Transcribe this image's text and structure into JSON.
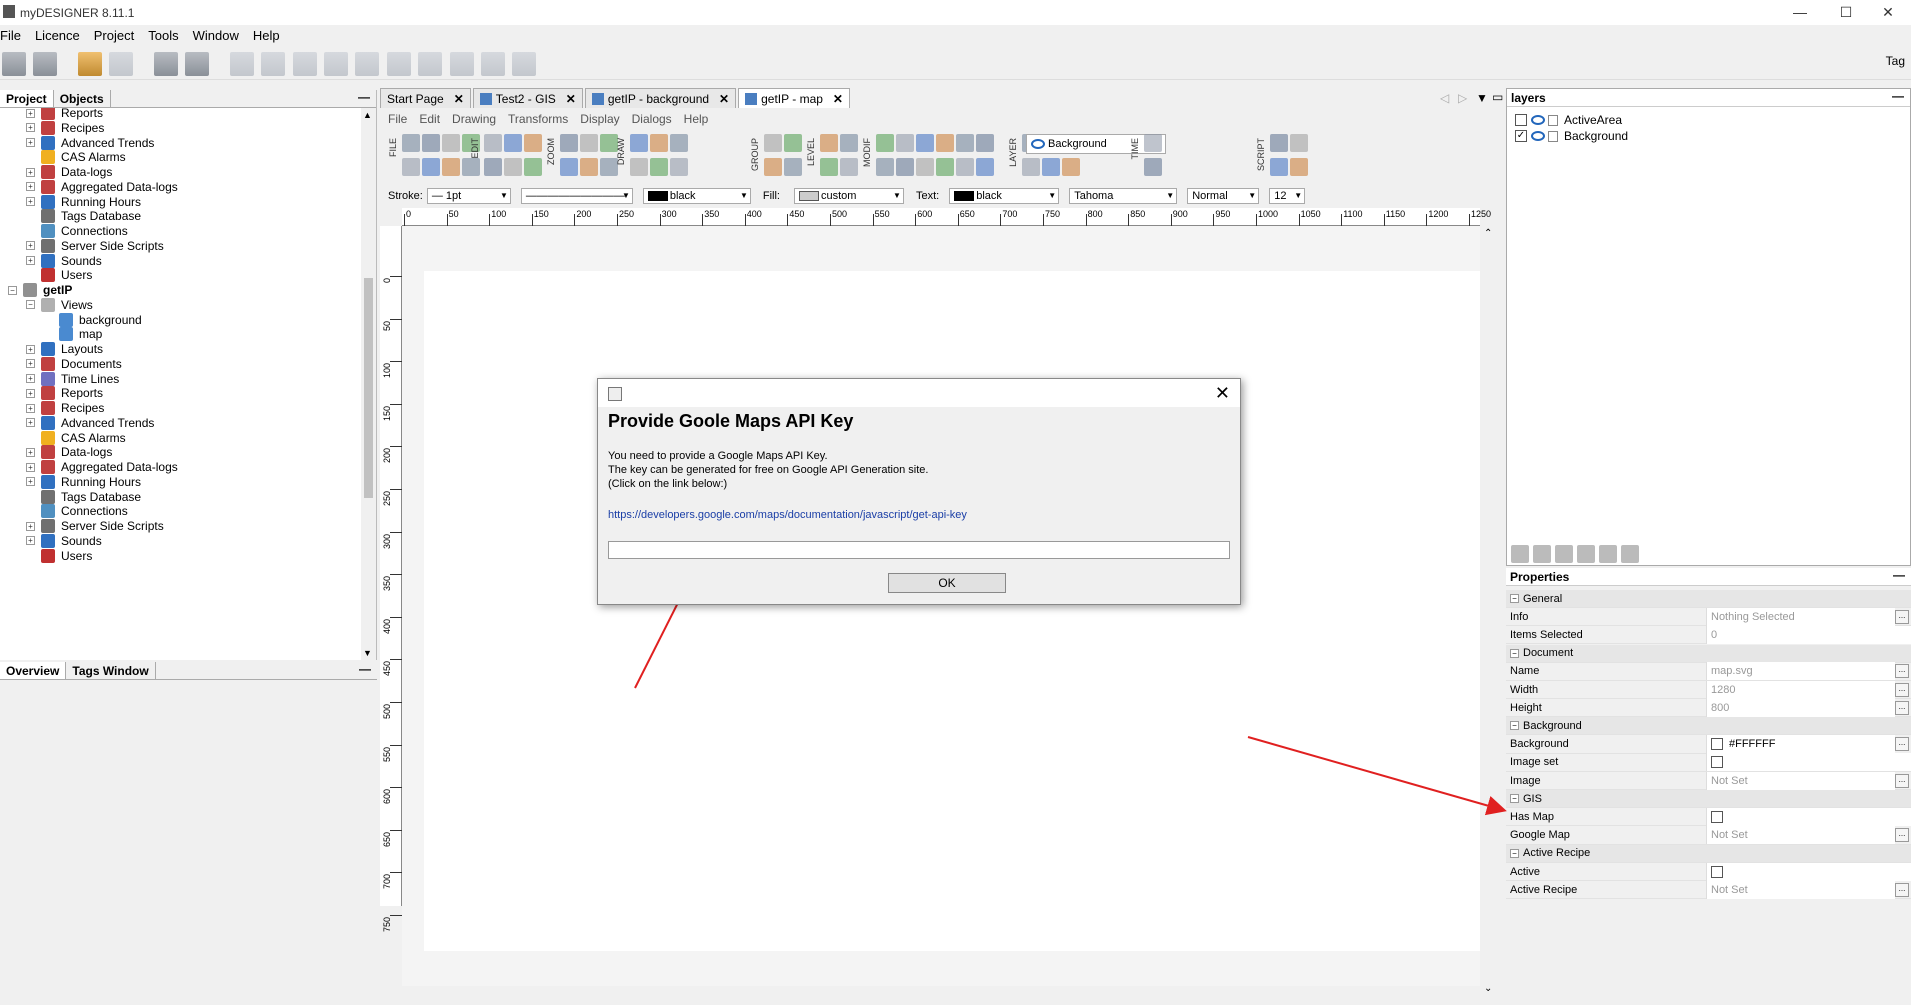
{
  "window": {
    "title": "myDESIGNER 8.11.1"
  },
  "menu": [
    "File",
    "Licence",
    "Project",
    "Tools",
    "Window",
    "Help"
  ],
  "toolbar": {
    "right_label": "Tag"
  },
  "left_panel": {
    "tabs": [
      "Project",
      "Objects"
    ],
    "tree": [
      {
        "label": "Reports",
        "level": 1,
        "exp": "+",
        "icon": "reports-icon",
        "color": "#c04040"
      },
      {
        "label": "Recipes",
        "level": 1,
        "exp": "+",
        "icon": "recipes-icon",
        "color": "#c04040"
      },
      {
        "label": "Advanced Trends",
        "level": 1,
        "exp": "+",
        "icon": "trend-icon",
        "color": "#3070c0"
      },
      {
        "label": "CAS Alarms",
        "level": 1,
        "exp": "",
        "icon": "alarm-icon",
        "color": "#f0b020"
      },
      {
        "label": "Data-logs",
        "level": 1,
        "exp": "+",
        "icon": "datalog-icon",
        "color": "#c04040"
      },
      {
        "label": "Aggregated Data-logs",
        "level": 1,
        "exp": "+",
        "icon": "aggregated-datalog-icon",
        "color": "#c04040"
      },
      {
        "label": "Running Hours",
        "level": 1,
        "exp": "+",
        "icon": "clock-icon",
        "color": "#3070c0"
      },
      {
        "label": "Tags Database",
        "level": 1,
        "exp": "",
        "icon": "database-icon",
        "color": "#707070"
      },
      {
        "label": "Connections",
        "level": 1,
        "exp": "",
        "icon": "connection-icon",
        "color": "#5090c0"
      },
      {
        "label": "Server Side Scripts",
        "level": 1,
        "exp": "+",
        "icon": "script-icon",
        "color": "#707070"
      },
      {
        "label": "Sounds",
        "level": 1,
        "exp": "+",
        "icon": "speaker-icon",
        "color": "#3070c0"
      },
      {
        "label": "Users",
        "level": 1,
        "exp": "",
        "icon": "users-icon",
        "color": "#c03030"
      },
      {
        "label": "getIP",
        "level": 0,
        "exp": "−",
        "icon": "project-icon",
        "color": "#909090",
        "bold": true
      },
      {
        "label": "Views",
        "level": 1,
        "exp": "−",
        "icon": "views-icon",
        "color": "#b0b0b0"
      },
      {
        "label": "background",
        "level": 2,
        "exp": "",
        "icon": "view-icon",
        "color": "#4a8ad0"
      },
      {
        "label": "map",
        "level": 2,
        "exp": "",
        "icon": "view-icon",
        "color": "#4a8ad0"
      },
      {
        "label": "Layouts",
        "level": 1,
        "exp": "+",
        "icon": "layouts-icon",
        "color": "#3070c0"
      },
      {
        "label": "Documents",
        "level": 1,
        "exp": "+",
        "icon": "documents-icon",
        "color": "#c04040"
      },
      {
        "label": "Time Lines",
        "level": 1,
        "exp": "+",
        "icon": "timeline-icon",
        "color": "#7070c0"
      },
      {
        "label": "Reports",
        "level": 1,
        "exp": "+",
        "icon": "reports-icon",
        "color": "#c04040"
      },
      {
        "label": "Recipes",
        "level": 1,
        "exp": "+",
        "icon": "recipes-icon",
        "color": "#c04040"
      },
      {
        "label": "Advanced Trends",
        "level": 1,
        "exp": "+",
        "icon": "trend-icon",
        "color": "#3070c0"
      },
      {
        "label": "CAS Alarms",
        "level": 1,
        "exp": "",
        "icon": "alarm-icon",
        "color": "#f0b020"
      },
      {
        "label": "Data-logs",
        "level": 1,
        "exp": "+",
        "icon": "datalog-icon",
        "color": "#c04040"
      },
      {
        "label": "Aggregated Data-logs",
        "level": 1,
        "exp": "+",
        "icon": "aggregated-datalog-icon",
        "color": "#c04040"
      },
      {
        "label": "Running Hours",
        "level": 1,
        "exp": "+",
        "icon": "clock-icon",
        "color": "#3070c0"
      },
      {
        "label": "Tags Database",
        "level": 1,
        "exp": "",
        "icon": "database-icon",
        "color": "#707070"
      },
      {
        "label": "Connections",
        "level": 1,
        "exp": "",
        "icon": "connection-icon",
        "color": "#5090c0"
      },
      {
        "label": "Server Side Scripts",
        "level": 1,
        "exp": "+",
        "icon": "script-icon",
        "color": "#707070"
      },
      {
        "label": "Sounds",
        "level": 1,
        "exp": "+",
        "icon": "speaker-icon",
        "color": "#3070c0"
      },
      {
        "label": "Users",
        "level": 1,
        "exp": "",
        "icon": "users-icon",
        "color": "#c03030"
      }
    ],
    "bottom_tabs": [
      "Overview",
      "Tags Window"
    ]
  },
  "doc_tabs": [
    {
      "label": "Start Page",
      "active": false,
      "icon": false
    },
    {
      "label": "Test2 - GIS",
      "active": false,
      "icon": true
    },
    {
      "label": "getIP - background",
      "active": false,
      "icon": true
    },
    {
      "label": "getIP - map",
      "active": true,
      "icon": true
    }
  ],
  "inner_menu": [
    "File",
    "Edit",
    "Drawing",
    "Transforms",
    "Display",
    "Dialogs",
    "Help"
  ],
  "tool_groups": [
    "FILE",
    "EDIT",
    "ZOOM",
    "DRAW",
    "GROUP",
    "LEVEL",
    "MODIF",
    "LAYER",
    "TIME",
    "SCRIPT"
  ],
  "layer_select": "Background",
  "prop_bar": {
    "stroke_label": "Stroke:",
    "stroke_width": "1pt",
    "stroke_color": "black",
    "fill_label": "Fill:",
    "fill_value": "custom",
    "text_label": "Text:",
    "text_color": "black",
    "font": "Tahoma",
    "style": "Normal",
    "size": "12"
  },
  "ruler_h": [
    "0",
    "50",
    "100",
    "150",
    "200",
    "250",
    "300",
    "350",
    "400",
    "450",
    "500",
    "550",
    "600",
    "650",
    "700",
    "750",
    "800",
    "850",
    "900",
    "950",
    "1000",
    "1050",
    "1100",
    "1150",
    "1200",
    "1250"
  ],
  "ruler_v": [
    "0",
    "50",
    "100",
    "150",
    "200",
    "250",
    "300",
    "350",
    "400",
    "450",
    "500",
    "550",
    "600",
    "650",
    "700",
    "750"
  ],
  "layers": {
    "title": "layers",
    "items": [
      {
        "name": "ActiveArea",
        "checked": false
      },
      {
        "name": "Background",
        "checked": true
      }
    ]
  },
  "properties": {
    "title": "Properties",
    "rows": [
      {
        "type": "section",
        "name": "General"
      },
      {
        "type": "prop",
        "name": "Info",
        "value": "Nothing Selected",
        "btn": true
      },
      {
        "type": "prop",
        "name": "Items Selected",
        "value": "0",
        "btn": false
      },
      {
        "type": "section",
        "name": "Document"
      },
      {
        "type": "prop",
        "name": "Name",
        "value": "map.svg",
        "btn": true
      },
      {
        "type": "prop",
        "name": "Width",
        "value": "1280",
        "btn": true
      },
      {
        "type": "prop",
        "name": "Height",
        "value": "800",
        "btn": true
      },
      {
        "type": "section",
        "name": "Background"
      },
      {
        "type": "prop",
        "name": "Background",
        "value": "#FFFFFF",
        "swatch": true,
        "btn": true
      },
      {
        "type": "prop",
        "name": "Image set",
        "checkbox": true,
        "btn": false
      },
      {
        "type": "prop",
        "name": "Image",
        "value": "Not Set",
        "btn": true
      },
      {
        "type": "section",
        "name": "GIS"
      },
      {
        "type": "prop",
        "name": "Has Map",
        "checkbox": true,
        "btn": false
      },
      {
        "type": "prop",
        "name": "Google Map",
        "value": "Not Set",
        "btn": true
      },
      {
        "type": "section",
        "name": "Active Recipe"
      },
      {
        "type": "prop",
        "name": "Active",
        "checkbox": true,
        "btn": false
      },
      {
        "type": "prop",
        "name": "Active Recipe",
        "value": "Not Set",
        "btn": true
      }
    ]
  },
  "dialog": {
    "heading": "Provide Goole Maps API Key",
    "body": [
      "You need to provide a Google Maps API Key.",
      "The key can be generated for free on Google API Generation site.",
      "(Click on the link below:)"
    ],
    "link": "https://developers.google.com/maps/documentation/javascript/get-api-key",
    "input_value": "",
    "ok_label": "OK"
  },
  "colors": {
    "annotation_arrow": "#e02020",
    "link": "#1a3ea6",
    "accent": "#2266bb"
  }
}
